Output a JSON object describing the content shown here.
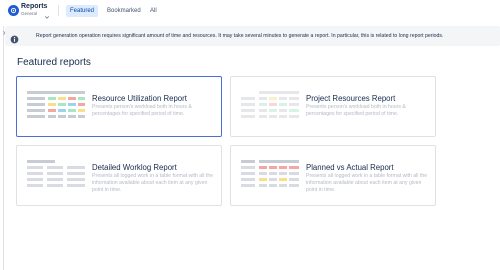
{
  "header": {
    "app_name": "Reports",
    "app_sub": "General",
    "tabs": [
      {
        "label": "Featured",
        "active": true
      },
      {
        "label": "Bookmarked",
        "active": false
      },
      {
        "label": "All",
        "active": false
      }
    ]
  },
  "banner": {
    "icon": "info-circle-icon",
    "text": "Report generation operation requires significant amount of time and resources. It may take several minutes to generate a report. In particular, this is related to long report periods."
  },
  "featured": {
    "title": "Featured reports",
    "cards": [
      {
        "title": "Resource Utilization Report",
        "desc": "Presents person's workload both in hours & percentages for specified period of time.",
        "selected": true
      },
      {
        "title": "Project Resources Report",
        "desc": "Presents person's workload both in hours & percentages for specified period of time.",
        "selected": false
      },
      {
        "title": "Detailed Worklog Report",
        "desc": "Presents all logged work in a table format with all the information available about each item at any given point in time.",
        "selected": false
      },
      {
        "title": "Planned vs Actual Report",
        "desc": "Presents all logged work in a table format with all the information available about each item at any given point in time.",
        "selected": false
      }
    ]
  },
  "colors": {
    "accent": "#1f5bd6",
    "tab_active_bg": "#deebff",
    "selected_border": "#4c6fd6",
    "thumb_red": "#f4a6a3",
    "thumb_green": "#a8e6c4",
    "thumb_yellow": "#f8e08a",
    "thumb_blue": "#9ed3ef",
    "thumb_gray": "#c7ccd4"
  }
}
